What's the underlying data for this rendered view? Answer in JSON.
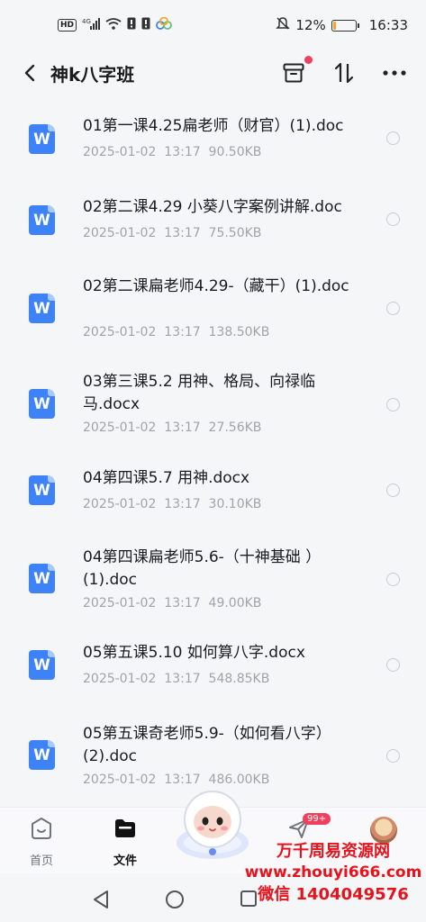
{
  "status_bar": {
    "battery": "12%",
    "time": "16:33",
    "network": "4G"
  },
  "header": {
    "title": "神k八字班"
  },
  "icons": {
    "back": "back-arrow-icon",
    "archive": "box-icon",
    "sort": "sort-icon",
    "more": "more-icon"
  },
  "files": [
    {
      "name": "01第一课4.25扁老师（财官）(1).doc",
      "date": "2025-01-02",
      "time": "13:17",
      "size": "90.50KB"
    },
    {
      "name": "02第二课4.29 小葵八字案例讲解.doc",
      "date": "2025-01-02",
      "time": "13:17",
      "size": "75.50KB"
    },
    {
      "name": "02第二课扁老师4.29-（藏干）(1).doc",
      "date": "2025-01-02",
      "time": "13:17",
      "size": "138.50KB"
    },
    {
      "name": "03第三课5.2 用神、格局、向禄临马.docx",
      "date": "2025-01-02",
      "time": "13:17",
      "size": "27.56KB"
    },
    {
      "name": "04第四课5.7  用神.docx",
      "date": "2025-01-02",
      "time": "13:17",
      "size": "30.10KB"
    },
    {
      "name": "04第四课扁老师5.6-（十神基础 ）(1).doc",
      "date": "2025-01-02",
      "time": "13:17",
      "size": "49.00KB"
    },
    {
      "name": "05第五课5.10  如何算八字.docx",
      "date": "2025-01-02",
      "time": "13:17",
      "size": "548.85KB"
    },
    {
      "name": "05第五课奇老师5.9-（如何看八字）(2).doc",
      "date": "2025-01-02",
      "time": "13:17",
      "size": "486.00KB"
    }
  ],
  "file_icon_letter": "W",
  "tabs": [
    {
      "label": "首页"
    },
    {
      "label": "文件"
    },
    {
      "label": ""
    },
    {
      "label": ""
    },
    {
      "label": ""
    }
  ],
  "message_badge": "99+",
  "watermark": {
    "line1": "万千周易资源网",
    "line2": "www.zhouyi666.com",
    "line3": "微信 1404049576"
  },
  "colors": {
    "accent": "#3d82f6",
    "badge": "#f0405e",
    "watermark": "#e8121c"
  }
}
